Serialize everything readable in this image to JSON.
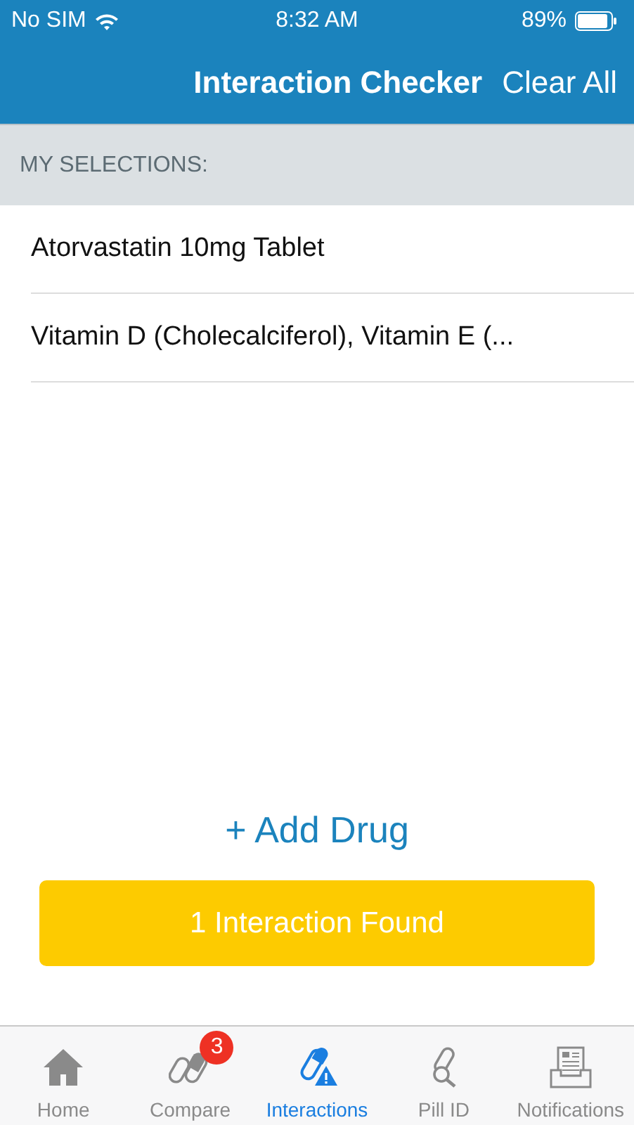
{
  "status_bar": {
    "carrier": "No SIM",
    "time": "8:32 AM",
    "battery": "89%"
  },
  "nav_bar": {
    "title": "Interaction Checker",
    "action": "Clear All"
  },
  "section_header": "MY SELECTIONS:",
  "selections": [
    "Atorvastatin 10mg Tablet",
    "Vitamin D (Cholecalciferol), Vitamin E (..."
  ],
  "add_link": "+ Add Drug",
  "result_button": "1 Interaction Found",
  "tabs": [
    {
      "kind": "home",
      "label": "Home",
      "selected": false
    },
    {
      "kind": "compare",
      "label": "Compare",
      "selected": false,
      "badge": "3"
    },
    {
      "kind": "interactions",
      "label": "Interactions",
      "selected": true
    },
    {
      "kind": "pill",
      "label": "Pill ID",
      "selected": false
    },
    {
      "kind": "notifications",
      "label": "Notifications",
      "selected": false
    }
  ]
}
